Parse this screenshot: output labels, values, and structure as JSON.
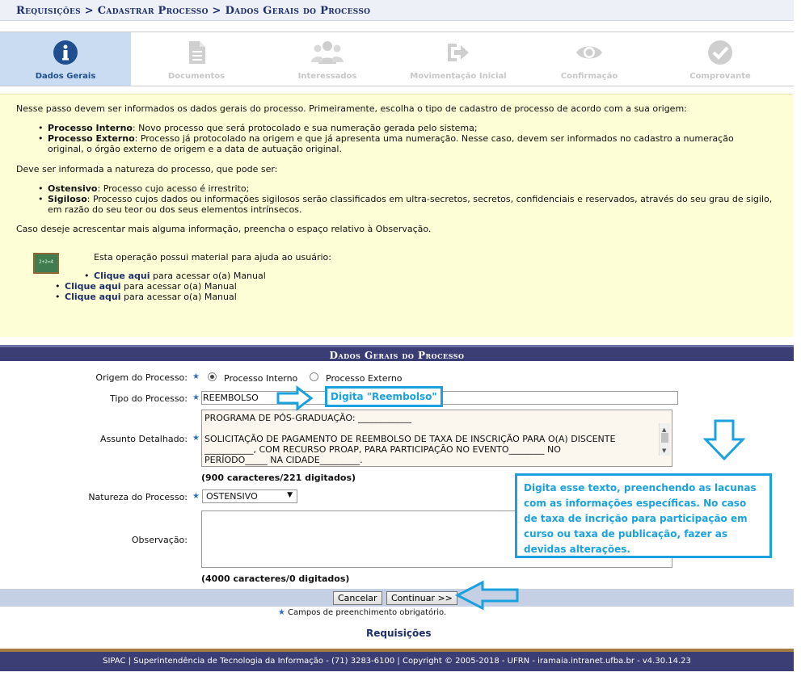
{
  "breadcrumb": "Requisições > Cadastrar Processo > Dados Gerais do Processo",
  "steps": [
    {
      "label": "Dados Gerais",
      "icon": "info-icon",
      "active": true
    },
    {
      "label": "Documentos",
      "icon": "document-icon",
      "active": false
    },
    {
      "label": "Interessados",
      "icon": "users-icon",
      "active": false
    },
    {
      "label": "Movimentação Inicial",
      "icon": "sign-out-icon",
      "active": false
    },
    {
      "label": "Confirmação",
      "icon": "eye-icon",
      "active": false
    },
    {
      "label": "Comprovante",
      "icon": "check-icon",
      "active": false
    }
  ],
  "help": {
    "intro": "Nesse passo devem ser informados os dados gerais do processo. Primeiramente, escolha o tipo de cadastro de processo de acordo com a sua origem:",
    "origins": [
      {
        "term": "Processo Interno",
        "desc": ": Novo processo que será protocolado e sua numeração gerada pelo sistema;"
      },
      {
        "term": "Processo Externo",
        "desc": ": Processo já protocolado na origem e que já apresenta uma numeração. Nesse caso, devem ser informados no cadastro a numeração original, o órgão externo de origem e a data de autuação original."
      }
    ],
    "nature_intro": "Deve ser informada a natureza do processo, que pode ser:",
    "natures": [
      {
        "term": "Ostensivo",
        "desc": ": Processo cujo acesso é irrestrito;"
      },
      {
        "term": "Sigiloso",
        "desc": ": Processo cujos dados ou informações sigilosos serão classificados em ultra-secretos, secretos, confidenciais e reservados, através do seu grau de sigilo, em razão do seu teor ou dos seus elementos intrínsecos."
      }
    ],
    "obs_text": "Caso deseje acrescentar mais alguma informação, preencha o espaço relativo à Observação.",
    "material_text": "Esta operação possui material para ajuda ao usuário:",
    "links": [
      {
        "link": "Clique aqui",
        "rest": " para acessar o(a) Manual"
      },
      {
        "link": "Clique aqui",
        "rest": " para acessar o(a) Manual"
      },
      {
        "link": "Clique aqui",
        "rest": " para acessar o(a) Manual"
      }
    ]
  },
  "form": {
    "section_title": "Dados Gerais do Processo",
    "origem_label": "Origem do Processo:",
    "origem_interno": "Processo Interno",
    "origem_externo": "Processo Externo",
    "tipo_label": "Tipo do Processo:",
    "tipo_value": "REEMBOLSO",
    "assunto_label": "Assunto Detalhado:",
    "assunto_lines": [
      "PROGRAMA DE PÓS-GRADUAÇÃO: ____________",
      "",
      "SOLICITAÇÃO DE PAGAMENTO DE REEMBOLSO DE TAXA DE INSCRIÇÃO PARA O(A) DISCENTE",
      "___________, COM RECURSO PROAP, PARA PARTICIPAÇÃO NO EVENTO________ NO",
      "PERÍODO_____ NA CIDADE_________."
    ],
    "assunto_counter": "(900 caracteres/221 digitados)",
    "natureza_label": "Natureza do Processo:",
    "natureza_value": "OSTENSIVO",
    "observacao_label": "Observação:",
    "observacao_value": "",
    "observacao_counter": "(4000 caracteres/0 digitados)",
    "cancel_label": "Cancelar",
    "continue_label": "Continuar >>",
    "required_note": "Campos de preenchimento obrigatório.",
    "requisicoes_link": "Requisições"
  },
  "annotations": {
    "tipo_hint": "Digita \"Reembolso\"",
    "assunto_hint": "Digita esse texto, preenchendo as lacunas com as informações específicas. No caso de taxa de incrição para participação em curso ou taxa de publicação, fazer as devidas alterações."
  },
  "footer": "SIPAC | Superintendência de Tecnologia da Informação - (71) 3283-6100 | Copyright © 2005-2018 - UFRN - iramaia.intranet.ufba.br - v4.30.14.23",
  "colors": {
    "header_bar": "#3b3e74",
    "help_bg": "#fefed6",
    "active_step": "#c9dcf1",
    "annotation": "#1aa1de"
  }
}
